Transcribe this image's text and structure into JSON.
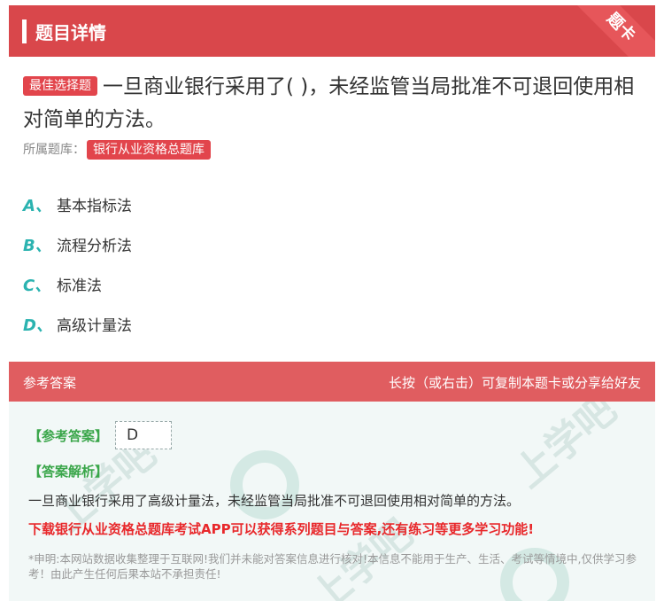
{
  "header": {
    "title": "题目详情",
    "ribbon": "题卡"
  },
  "question": {
    "type_tag": "最佳选择题",
    "text": "一旦商业银行采用了( )，未经监管当局批准不可退回使用相对简单的方法。",
    "bank_label": "所属题库：",
    "bank_name": "银行从业资格总题库"
  },
  "options": [
    {
      "letter": "A、",
      "text": "基本指标法"
    },
    {
      "letter": "B、",
      "text": "流程分析法"
    },
    {
      "letter": "C、",
      "text": "标准法"
    },
    {
      "letter": "D、",
      "text": "高级计量法"
    }
  ],
  "answer_section": {
    "title": "参考答案",
    "hint": "长按（或右击）可复制本题卡或分享给好友",
    "answer_label": "【参考答案】",
    "answer_value": "D",
    "explanation_label": "【答案解析】",
    "explanation": "一旦商业银行采用了高级计量法，未经监管当局批准不可退回使用相对简单的方法。",
    "promo": "下载银行从业资格总题库考试APP可以获得系列题目与答案,还有练习等更多学习功能!",
    "disclaimer": "*申明:本网站数据收集整理于互联网!我们并未能对答案信息进行核对!本信息不能用于生产、生活、考试等情境中,仅供学习参考！由此产生任何后果本站不承担责任!"
  },
  "colors": {
    "header_red": "#d9474b",
    "accent_teal": "#2bb3b0",
    "answer_green": "#3aa64a",
    "promo_red": "#e8282b"
  }
}
